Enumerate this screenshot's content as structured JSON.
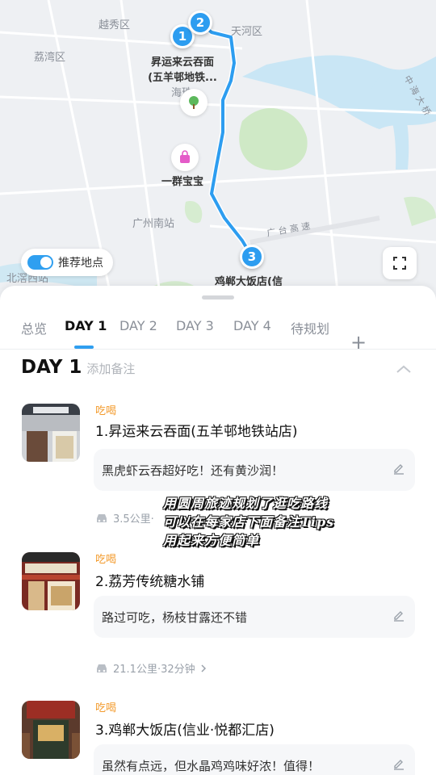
{
  "map": {
    "district_labels": [
      "越秀区",
      "天河区",
      "荔湾区",
      "海珠",
      "广州南站",
      "北滘西站"
    ],
    "road_label": "广 台 高 速",
    "river_road_label": "中 海 大 桥",
    "stops_on_map": [
      {
        "number": "1",
        "label": "昇运来云吞面\n(五羊邨地铁..."
      },
      {
        "number": "2",
        "label": ""
      },
      {
        "number": "3",
        "label": "鸡郸大饭店(信"
      }
    ],
    "poi_label": "一群宝宝",
    "toggle_label": "推荐地点",
    "toggle_on": true,
    "route_color": "#2d9df0"
  },
  "tabs": {
    "items": [
      "总览",
      "DAY 1",
      "DAY 2",
      "DAY 3",
      "DAY 4",
      "待规划"
    ],
    "active": "DAY 1",
    "add_label": "+"
  },
  "day": {
    "title": "DAY 1",
    "note_placeholder": "添加备注"
  },
  "stops": [
    {
      "category": "吃喝",
      "name": "1.昇运来云吞面(五羊邨地铁站店)",
      "note": "黑虎虾云吞超好吃！还有黄沙润！",
      "transit": "3.5公里·"
    },
    {
      "category": "吃喝",
      "name": "2.荔芳传统糖水铺",
      "note": "路过可吃，杨枝甘露还不错",
      "transit": "21.1公里·32分钟"
    },
    {
      "category": "吃喝",
      "name": "3.鸡郸大饭店(信业·悦都汇店)",
      "note": "虽然有点远，但水晶鸡鸡味好浓！值得！",
      "transit": ""
    }
  ],
  "overlay": {
    "lines": [
      "用圆周旅迹规划了逛吃路线",
      "可以在每家店下面备注Tips",
      "用起来方便简单"
    ]
  },
  "colors": {
    "accent": "#2f9ff0",
    "category": "#f39a2b"
  }
}
